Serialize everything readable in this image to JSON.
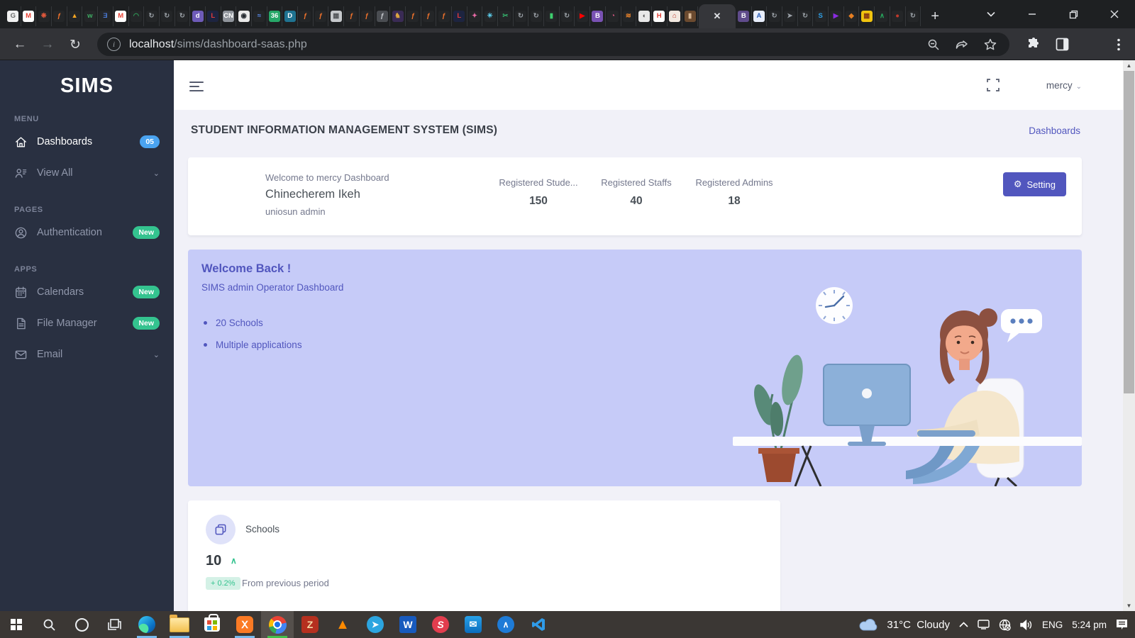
{
  "browser": {
    "url": {
      "host": "localhost",
      "path": "/sims/dashboard-saas.php"
    },
    "nav": {
      "back": "←",
      "forward": "→",
      "reload": "↻"
    },
    "active_tab_close": "✕",
    "new_tab": "+",
    "window_controls": {
      "tab_search": "⌄",
      "minimize": "—",
      "restore": "❐",
      "close": "✕"
    },
    "tabs_before": [
      {
        "g": "G",
        "bg": "#f1f1f1",
        "fg": "#6b6b6b"
      },
      {
        "g": "M",
        "bg": "#ffffff",
        "fg": "#ea4335"
      },
      {
        "g": "❋",
        "bg": "#242628",
        "fg": "#e4593c"
      },
      {
        "g": "ƒ",
        "bg": "#242628",
        "fg": "#f4742c"
      },
      {
        "g": "▲",
        "bg": "#242628",
        "fg": "#f6a623"
      },
      {
        "g": "w",
        "bg": "#242628",
        "fg": "#3faf64"
      },
      {
        "g": "Ǝ",
        "bg": "#242628",
        "fg": "#4a7bd8"
      },
      {
        "g": "M",
        "bg": "#ffffff",
        "fg": "#ea4335"
      },
      {
        "g": "◠",
        "bg": "#242628",
        "fg": "#2f9e58"
      },
      {
        "g": "↻",
        "bg": "#242628",
        "fg": "#9aa0a6"
      },
      {
        "g": "↻",
        "bg": "#242628",
        "fg": "#9aa0a6"
      },
      {
        "g": "↻",
        "bg": "#242628",
        "fg": "#9aa0a6"
      },
      {
        "g": "d",
        "bg": "#6e5bb8",
        "fg": "#ffffff"
      },
      {
        "g": "L",
        "bg": "#1d2440",
        "fg": "#e23b3b"
      },
      {
        "g": "CN",
        "bg": "#90959c",
        "fg": "#ffffff"
      },
      {
        "g": "◉",
        "bg": "#e9e9e9",
        "fg": "#24292f"
      },
      {
        "g": "≈",
        "bg": "#242628",
        "fg": "#5b8def"
      },
      {
        "g": "36",
        "bg": "#27a768",
        "fg": "#ffffff"
      },
      {
        "g": "D",
        "bg": "#1f7391",
        "fg": "#ffffff"
      },
      {
        "g": "ƒ",
        "bg": "#242628",
        "fg": "#f4742c"
      },
      {
        "g": "ƒ",
        "bg": "#242628",
        "fg": "#f4742c"
      },
      {
        "g": "▦",
        "bg": "#c6c9cc",
        "fg": "#55585c"
      },
      {
        "g": "ƒ",
        "bg": "#242628",
        "fg": "#f4742c"
      },
      {
        "g": "ƒ",
        "bg": "#242628",
        "fg": "#f4742c"
      },
      {
        "g": "ƒ",
        "bg": "#4a4d52",
        "fg": "#c9ccd1"
      },
      {
        "g": "♞",
        "bg": "#3a2b55",
        "fg": "#d9a441"
      },
      {
        "g": "ƒ",
        "bg": "#242628",
        "fg": "#f4742c"
      },
      {
        "g": "ƒ",
        "bg": "#242628",
        "fg": "#f4742c"
      },
      {
        "g": "ƒ",
        "bg": "#242628",
        "fg": "#f4742c"
      },
      {
        "g": "L",
        "bg": "#1d2440",
        "fg": "#e23b3b"
      },
      {
        "g": "✦",
        "bg": "#242628",
        "fg": "#e86aa6"
      },
      {
        "g": "✳",
        "bg": "#242628",
        "fg": "#5ed4f3"
      },
      {
        "g": "✂",
        "bg": "#242628",
        "fg": "#35b86f"
      },
      {
        "g": "↻",
        "bg": "#242628",
        "fg": "#9aa0a6"
      },
      {
        "g": "↻",
        "bg": "#242628",
        "fg": "#9aa0a6"
      },
      {
        "g": "▮",
        "bg": "#242628",
        "fg": "#3ecf6e"
      },
      {
        "g": "↻",
        "bg": "#242628",
        "fg": "#9aa0a6"
      },
      {
        "g": "▶",
        "bg": "#242628",
        "fg": "#ff0000"
      },
      {
        "g": "B",
        "bg": "#7952b3",
        "fg": "#ffffff"
      },
      {
        "g": "◔",
        "bg": "#242628",
        "fg": "#e85c8a"
      },
      {
        "g": "≋",
        "bg": "#242628",
        "fg": "#f0862b"
      },
      {
        "g": "◖",
        "bg": "#e8e8e8",
        "fg": "#555555"
      },
      {
        "g": "H",
        "bg": "#ffffff",
        "fg": "#e03c31"
      },
      {
        "g": "⌂",
        "bg": "#f2e8e0",
        "fg": "#c0392b"
      },
      {
        "g": "▮",
        "bg": "#6b4a2f",
        "fg": "#d9b896"
      }
    ],
    "tabs_after": [
      {
        "g": "B",
        "bg": "#5f4b8b",
        "fg": "#ffffff"
      },
      {
        "g": "A",
        "bg": "#e8eefc",
        "fg": "#2b5fb8"
      },
      {
        "g": "↻",
        "bg": "#242628",
        "fg": "#9aa0a6"
      },
      {
        "g": "➤",
        "bg": "#242628",
        "fg": "#9aa0a6"
      },
      {
        "g": "↻",
        "bg": "#242628",
        "fg": "#9aa0a6"
      },
      {
        "g": "S",
        "bg": "#242628",
        "fg": "#2e9fe6"
      },
      {
        "g": "▶",
        "bg": "#242628",
        "fg": "#8a2be2"
      },
      {
        "g": "◆",
        "bg": "#242628",
        "fg": "#e67e22"
      },
      {
        "g": "▦",
        "bg": "#f1c40f",
        "fg": "#8a3b12"
      },
      {
        "g": "∧",
        "bg": "#242628",
        "fg": "#27ae60"
      },
      {
        "g": "●",
        "bg": "#242628",
        "fg": "#c0392b"
      },
      {
        "g": "↻",
        "bg": "#242628",
        "fg": "#9aa0a6"
      }
    ]
  },
  "sidebar": {
    "logo": "SIMS",
    "sections": [
      {
        "label": "MENU",
        "items": [
          {
            "icon": "home",
            "label": "Dashboards",
            "badge": "05",
            "badge_style": "info",
            "active": true
          },
          {
            "icon": "users",
            "label": "View All",
            "chevron": true
          }
        ]
      },
      {
        "label": "PAGES",
        "items": [
          {
            "icon": "user-circle",
            "label": "Authentication",
            "badge": "New",
            "badge_style": "success"
          }
        ]
      },
      {
        "label": "APPS",
        "items": [
          {
            "icon": "calendar",
            "label": "Calendars",
            "badge": "New",
            "badge_style": "success"
          },
          {
            "icon": "file",
            "label": "File Manager",
            "badge": "New",
            "badge_style": "success"
          },
          {
            "icon": "mail",
            "label": "Email",
            "chevron": true
          }
        ]
      }
    ]
  },
  "header": {
    "user_name": "mercy"
  },
  "page": {
    "title": "STUDENT INFORMATION MANAGEMENT SYSTEM (SIMS)",
    "breadcrumb": "Dashboards",
    "welcome_card": {
      "greeting": "Welcome to mercy Dashboard",
      "name": "Chinecherem Ikeh",
      "role": "uniosun admin",
      "stats": [
        {
          "label": "Registered Stude...",
          "value": "150"
        },
        {
          "label": "Registered Staffs",
          "value": "40"
        },
        {
          "label": "Registered Admins",
          "value": "18"
        }
      ],
      "setting_label": "Setting",
      "setting_icon": "⚙"
    },
    "banner": {
      "title": "Welcome Back !",
      "subtitle": "SIMS admin Operator Dashboard",
      "bullets": [
        "20 Schools",
        "Multiple applications"
      ]
    },
    "schools_card": {
      "label": "Schools",
      "value": "10",
      "caret": "∧",
      "delta": "+ 0.2%",
      "delta_note": "From previous period"
    },
    "accent_color": "#5156be",
    "success_color": "#34c38f",
    "banner_bg": "#c6cbf8"
  },
  "taskbar": {
    "apps": [
      {
        "name": "edge",
        "underline": true
      },
      {
        "name": "explorer",
        "underline": true
      },
      {
        "name": "store",
        "underline": false
      },
      {
        "name": "xampp",
        "underline": true
      },
      {
        "name": "chrome",
        "underline": true,
        "active": true
      },
      {
        "name": "zotero"
      },
      {
        "name": "vlc"
      },
      {
        "name": "telegram"
      },
      {
        "name": "word"
      },
      {
        "name": "red-app"
      },
      {
        "name": "mail"
      },
      {
        "name": "blue-app"
      },
      {
        "name": "vscode"
      }
    ],
    "tray": {
      "temp": "31°C",
      "condition": "Cloudy",
      "lang": "ENG",
      "time": "5:24 pm"
    }
  }
}
